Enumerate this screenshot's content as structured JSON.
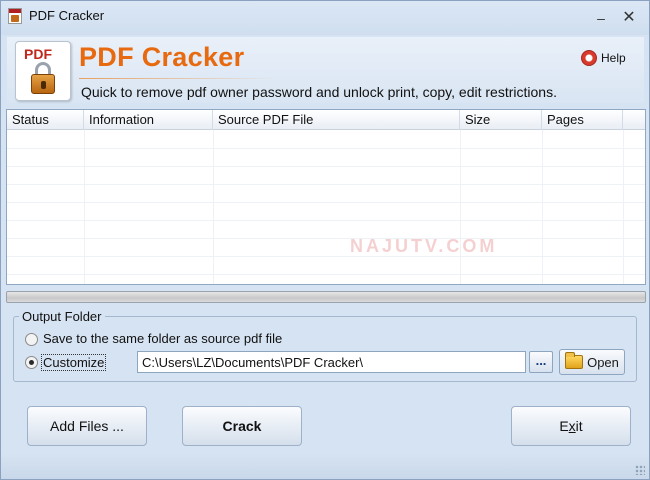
{
  "window": {
    "title": "PDF Cracker",
    "minimize_glyph": "–",
    "close_glyph": "✕"
  },
  "header": {
    "logo_text": "PDF",
    "app_name": "PDF Cracker",
    "tagline": "Quick to remove pdf owner password and unlock print, copy, edit restrictions.",
    "help_label": "Help",
    "help_icon": "lifebuoy-icon",
    "app_name_color": "#e86a10"
  },
  "list": {
    "columns": [
      "Status",
      "Information",
      "Source PDF File",
      "Size",
      "Pages"
    ],
    "rows": []
  },
  "watermark": "NAJUTV.COM",
  "progress": {
    "value": 0
  },
  "output_folder": {
    "title": "Output Folder",
    "option_same": "Save to the same folder as source pdf file",
    "option_custom": "Customize",
    "selected": "Customize",
    "path": "C:\\Users\\LZ\\Documents\\PDF Cracker\\",
    "browse_label": "...",
    "open_label": "Open"
  },
  "buttons": {
    "add_files": "Add Files ...",
    "crack": "Crack",
    "exit_prefix": "E",
    "exit_underlined": "x",
    "exit_suffix": "it"
  }
}
